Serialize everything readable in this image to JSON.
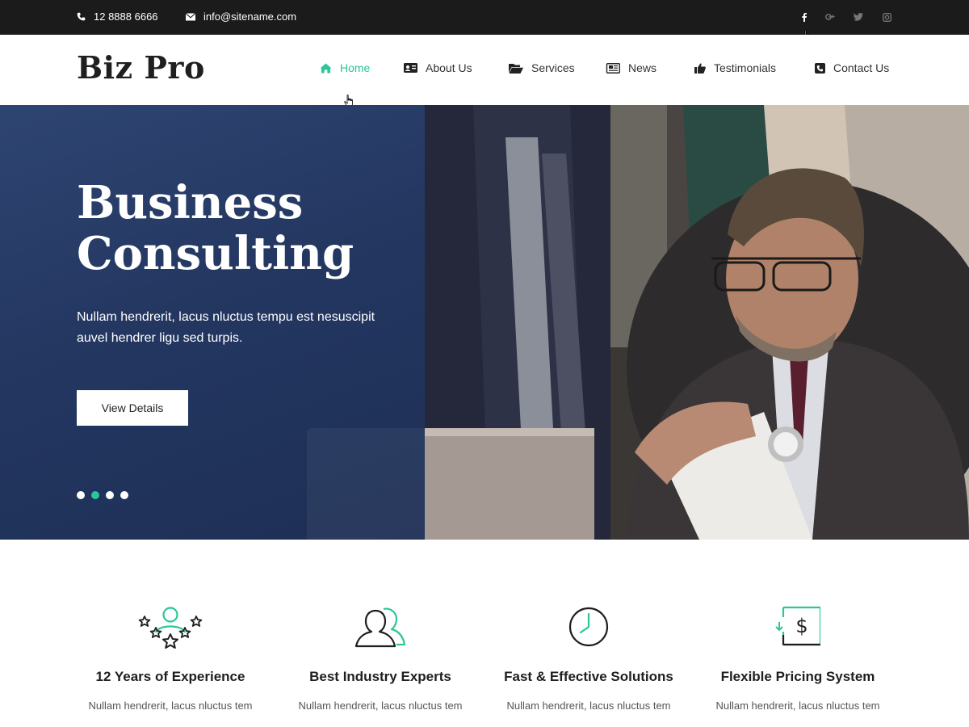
{
  "topbar": {
    "phone": "12 8888 6666",
    "email": "info@sitename.com",
    "social": [
      "facebook-icon",
      "google-plus-icon",
      "twitter-icon",
      "instagram-icon"
    ]
  },
  "header": {
    "logo": "Biz Pro",
    "nav": [
      {
        "label": "Home",
        "icon": "home-icon",
        "active": true
      },
      {
        "label": "About Us",
        "icon": "id-card-icon",
        "active": false
      },
      {
        "label": "Services",
        "icon": "folder-open-icon",
        "active": false
      },
      {
        "label": "News",
        "icon": "newspaper-icon",
        "active": false
      },
      {
        "label": "Testimonials",
        "icon": "thumbs-up-icon",
        "active": false
      },
      {
        "label": "Contact Us",
        "icon": "phone-square-icon",
        "active": false
      }
    ]
  },
  "hero": {
    "title_line1": "Business",
    "title_line2": "Consulting",
    "text": "Nullam hendrerit, lacus nluctus tempu est nesuscipit auvel hendrer ligu  sed turpis.",
    "button": "View Details",
    "slides": 4,
    "active_slide": 2
  },
  "features": [
    {
      "title": "12 Years of Experience",
      "text": "Nullam hendrerit, lacus nluctus tem",
      "icon": "user-stars-icon"
    },
    {
      "title": "Best Industry Experts",
      "text": "Nullam hendrerit, lacus nluctus tem",
      "icon": "users-icon"
    },
    {
      "title": "Fast & Effective Solutions",
      "text": "Nullam hendrerit, lacus nluctus tem",
      "icon": "clock-icon"
    },
    {
      "title": "Flexible Pricing System",
      "text": "Nullam hendrerit, lacus nluctus tem",
      "icon": "dollar-icon"
    }
  ],
  "colors": {
    "accent": "#2bc69a",
    "topbar_bg": "#1b1b1b",
    "hero_overlay": "#233761"
  }
}
